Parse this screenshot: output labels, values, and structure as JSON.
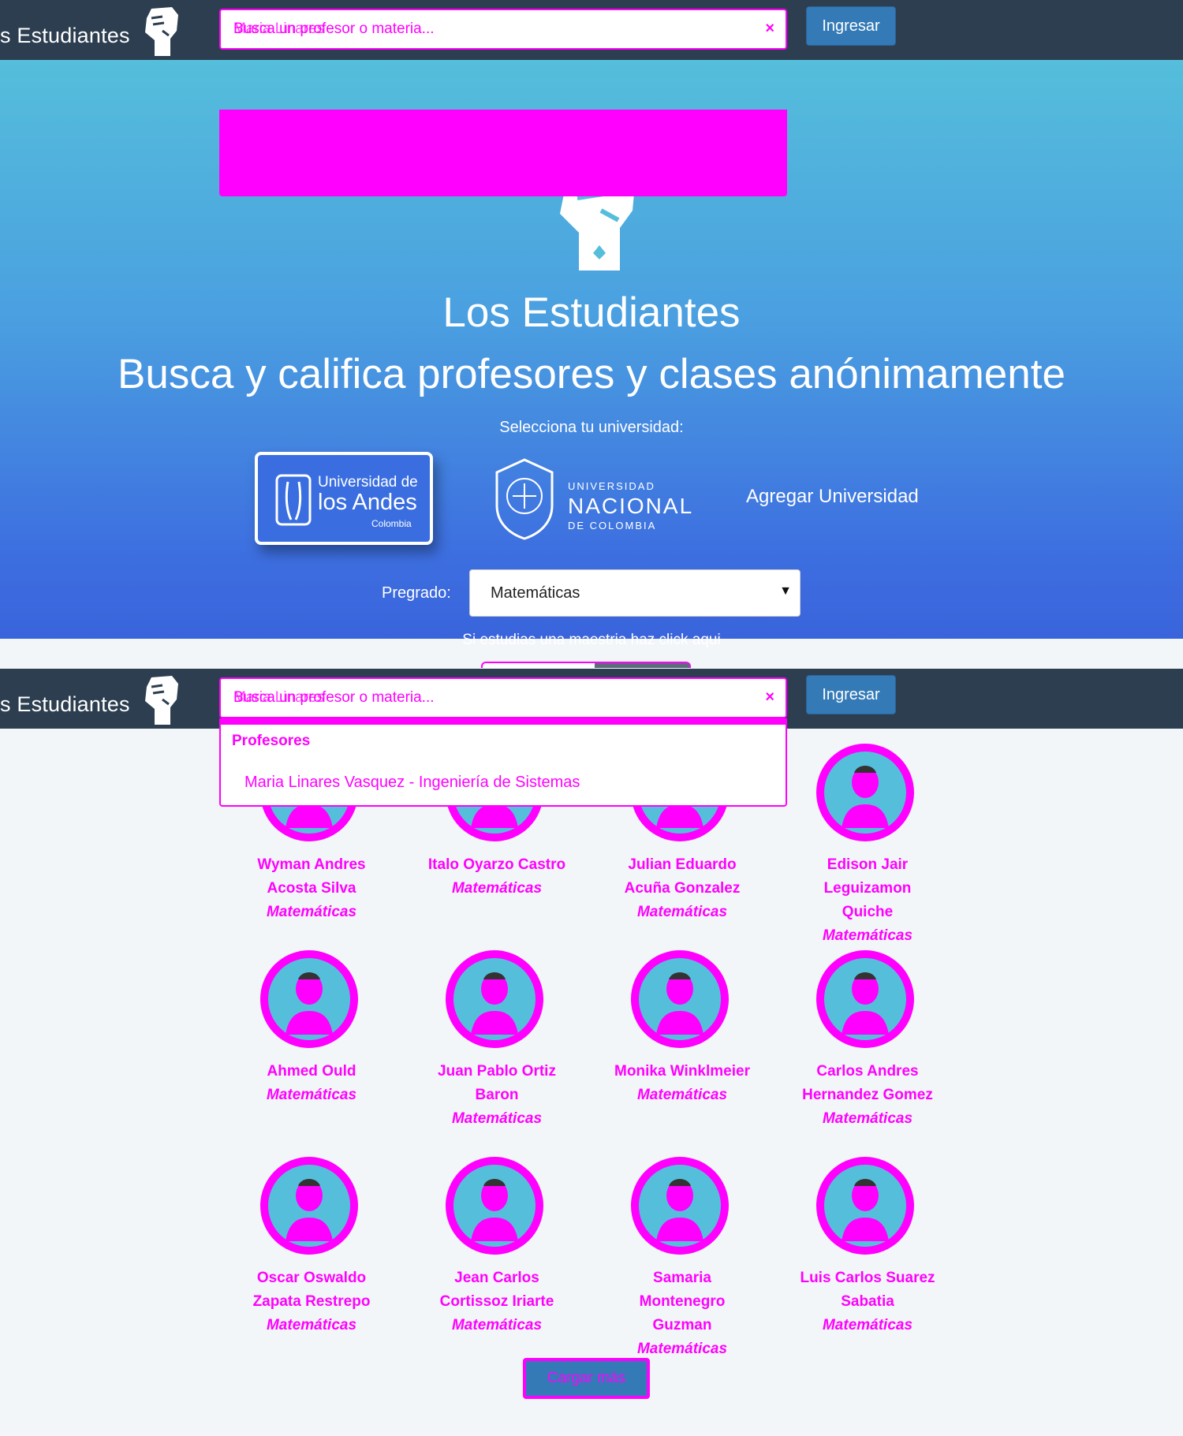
{
  "navbar": {
    "brand": "s Estudiantes",
    "search_placeholder": "Busca un profesor o materia...",
    "search_value": "Maria Linares",
    "clear_symbol": "×",
    "login_label": "Ingresar"
  },
  "hero": {
    "title": "Los Estudiantes",
    "subtitle": "Busca y califica profesores y clases anónimamente",
    "university_prompt": "Selecciona tu universidad:",
    "uni_andes": {
      "line1": "Universidad de",
      "line2": "los Andes",
      "line3": "Colombia"
    },
    "uni_nacional": {
      "line1": "UNIVERSIDAD",
      "line2": "NACIONAL",
      "line3": "DE COLOMBIA"
    },
    "add_university": "Agregar Universidad",
    "pregrado_label": "Pregrado:",
    "pregrado_value": "Matemáticas",
    "maestria_link": "Si estudias una maestria haz click aqui"
  },
  "results": {
    "header": "Profesores",
    "item": "Maria Linares Vasquez - Ingeniería de Sistemas"
  },
  "professors": [
    {
      "name": "Wyman Andres Acosta Silva",
      "subject": "Matemáticas"
    },
    {
      "name": "Italo Oyarzo Castro",
      "subject": "Matemáticas"
    },
    {
      "name": "Julian Eduardo Acuña Gonzalez",
      "subject": "Matemáticas"
    },
    {
      "name": "Edison Jair Leguizamon Quiche",
      "subject": "Matemáticas"
    },
    {
      "name": "Ahmed Ould",
      "subject": "Matemáticas"
    },
    {
      "name": "Juan Pablo Ortiz Baron",
      "subject": "Matemáticas"
    },
    {
      "name": "Monika Winklmeier",
      "subject": "Matemáticas"
    },
    {
      "name": "Carlos Andres Hernandez Gomez",
      "subject": "Matemáticas"
    },
    {
      "name": "Oscar Oswaldo Zapata Restrepo",
      "subject": "Matemáticas"
    },
    {
      "name": "Jean Carlos Cortissoz Iriarte",
      "subject": "Matemáticas"
    },
    {
      "name": "Samaria Montenegro Guzman",
      "subject": "Matemáticas"
    },
    {
      "name": "Luis Carlos Suarez Sabatia",
      "subject": "Matemáticas"
    }
  ],
  "more_button": "Cargar más",
  "colors": {
    "navbar": "#2c3e50",
    "accent": "#337ab7",
    "marker": "#ff00ff"
  }
}
